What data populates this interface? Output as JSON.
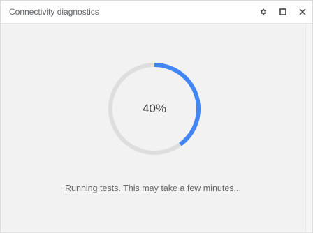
{
  "window": {
    "title": "Connectivity diagnostics"
  },
  "titlebar": {
    "icons": [
      "gear-icon",
      "maximize-icon",
      "close-icon"
    ]
  },
  "progress": {
    "value": 40,
    "label": "40%",
    "track_color": "#dedede",
    "fill_color": "#4285f4"
  },
  "status": {
    "text": "Running tests. This may take a few minutes..."
  }
}
